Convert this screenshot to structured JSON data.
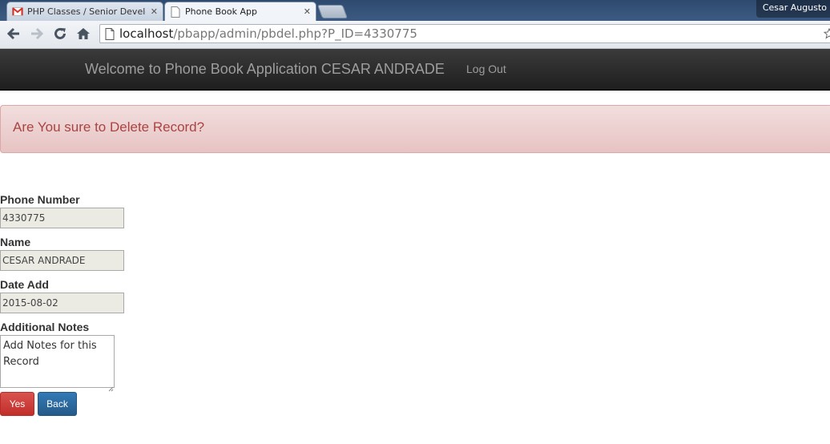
{
  "browser": {
    "tabs": [
      {
        "label": "PHP Classes / Senior Develop",
        "icon": "gmail-icon"
      },
      {
        "label": "Phone Book App",
        "icon": "page-icon"
      }
    ],
    "profile_name": "Cesar Augusto",
    "url": {
      "host": "localhost",
      "path": "/pbapp/admin/pbdel.php?P_ID=4330775"
    }
  },
  "navbar": {
    "brand": "Welcome to Phone Book Application CESAR ANDRADE",
    "logout": "Log Out"
  },
  "alert": {
    "message": "Are You sure to Delete Record?"
  },
  "form": {
    "phone_label": "Phone Number",
    "phone_value": "4330775",
    "name_label": "Name",
    "name_value": "CESAR ANDRADE",
    "date_label": "Date Add",
    "date_value": "2015-08-02",
    "notes_label": "Additional Notes",
    "notes_value": "Add Notes for this Record"
  },
  "buttons": {
    "yes": "Yes",
    "back": "Back"
  },
  "colors": {
    "navbar_bg": "#222222",
    "alert_bg": "#f2dede",
    "alert_text": "#a94442",
    "btn_danger": "#d9534f",
    "btn_primary": "#337ab7"
  }
}
